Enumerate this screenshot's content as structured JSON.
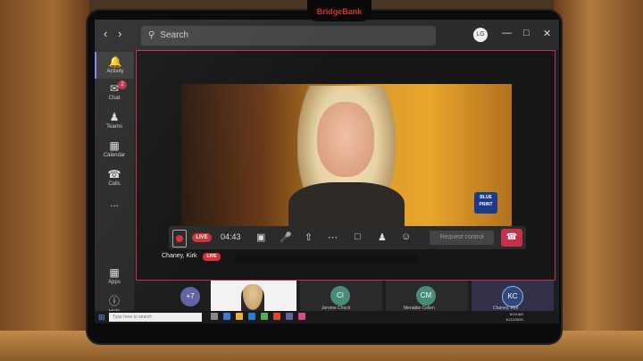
{
  "device": {
    "logo_text": "BridgeBank"
  },
  "titlebar": {
    "back_icon": "chevron-left-icon",
    "forward_icon": "chevron-right-icon",
    "search_placeholder": "Search",
    "avatar_initials": "LG"
  },
  "rail": {
    "items": [
      {
        "label": "Activity",
        "icon": "bell-icon",
        "active": true
      },
      {
        "label": "Chat",
        "icon": "chat-icon",
        "badge": "2"
      },
      {
        "label": "Teams",
        "icon": "teams-icon"
      },
      {
        "label": "Calendar",
        "icon": "calendar-icon"
      },
      {
        "label": "Calls",
        "icon": "phone-icon"
      },
      {
        "label": "...",
        "icon": "more-icon"
      },
      {
        "label": "Apps",
        "icon": "apps-icon"
      },
      {
        "label": "Help",
        "icon": "help-icon"
      }
    ]
  },
  "meeting": {
    "live_label": "LIVE",
    "timer": "04:43",
    "request_control_label": "Request control",
    "presenter_name": "Chaney, Kirk",
    "video_logo_text": "BLUE PRINT"
  },
  "participants": {
    "overflow_count": "+7",
    "tiles": [
      {
        "initials": "CI",
        "label": "Jerome Chuck"
      },
      {
        "initials": "CM",
        "label": "Menabie Colien"
      },
      {
        "initials": "KC",
        "label": "Chaney, Kirk"
      }
    ]
  },
  "taskbar": {
    "search_placeholder": "Type here to search",
    "time": "8:04 AM",
    "date": "11/12/2020"
  },
  "colors": {
    "accent": "#c4314b",
    "teams_purple": "#7b83eb",
    "live_red": "#d13438"
  }
}
